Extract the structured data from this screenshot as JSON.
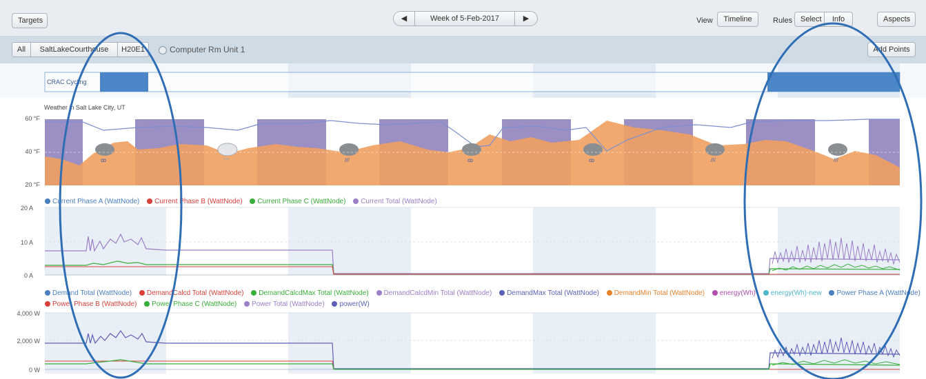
{
  "toolbar": {
    "targets_label": "Targets",
    "week_label": "Week of 5-Feb-2017",
    "view_label": "View",
    "timeline_label": "Timeline",
    "rules_label": "Rules",
    "select_label": "Select",
    "info_label": "Info",
    "aspects_label": "Aspects"
  },
  "breadcrumb": {
    "items": [
      "All",
      "SaltLakeCourthouse",
      "H20E1"
    ],
    "current": "Computer Rm Unit 1",
    "add_points_label": "Add Points"
  },
  "rules_row": {
    "label": "CRAC Cycling",
    "color": "#4a86c8",
    "segments": [
      [
        0.0,
        0.06
      ],
      [
        0.83,
        1.0
      ]
    ]
  },
  "weather": {
    "title": "Weather in Salt Lake City, UT",
    "y_ticks": [
      "60 °F",
      "40 °F",
      "20 °F"
    ],
    "temp_color": "#f0a060",
    "line_color": "#7b8fd0"
  },
  "current_chart": {
    "legend": [
      {
        "label": "Current Phase A (WattNode)",
        "color": "#4a7fc1"
      },
      {
        "label": "Current Phase B (WattNode)",
        "color": "#d9413b"
      },
      {
        "label": "Current Phase C (WattNode)",
        "color": "#3aae3a"
      },
      {
        "label": "Current Total (WattNode)",
        "color": "#9b7fc7"
      }
    ],
    "y_ticks": [
      "20 A",
      "10 A",
      "0 A"
    ]
  },
  "power_chart": {
    "legend_row1": [
      {
        "label": "Demand Total (WattNode)",
        "color": "#4a7fc1"
      },
      {
        "label": "DemandCalcd Total (WattNode)",
        "color": "#d9413b"
      },
      {
        "label": "DemandCalcdMax Total (WattNode)",
        "color": "#3aae3a"
      },
      {
        "label": "DemandCalcdMin Total (WattNode)",
        "color": "#9b7fc7"
      },
      {
        "label": "DemandMax Total (WattNode)",
        "color": "#5b5fb5"
      },
      {
        "label": "DemandMin Total (WattNode)",
        "color": "#e8822a"
      },
      {
        "label": "energy(Wh)",
        "color": "#b04fb0"
      },
      {
        "label": "energy(Wh)-new",
        "color": "#4fb8c8"
      },
      {
        "label": "Power Phase A (WattNode)",
        "color": "#4a7fc1"
      }
    ],
    "legend_row2": [
      {
        "label": "Power Phase B (WattNode)",
        "color": "#d9413b"
      },
      {
        "label": "Power Phase C (WattNode)",
        "color": "#3aae3a"
      },
      {
        "label": "Power Total (WattNode)",
        "color": "#9b7fc7"
      },
      {
        "label": "power(W)",
        "color": "#5b5fb5"
      }
    ],
    "y_ticks": [
      "4,000 W",
      "2,000 W",
      "0 W"
    ]
  }
}
